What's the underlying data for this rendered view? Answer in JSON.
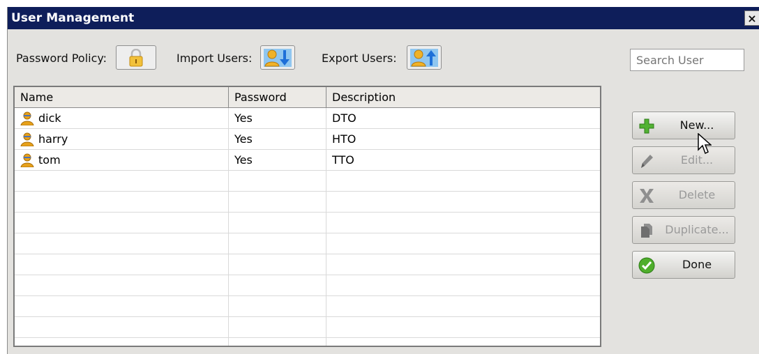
{
  "window": {
    "title": "User Management",
    "close_glyph": "×"
  },
  "toolbar": {
    "password_policy_label": "Password Policy:",
    "import_users_label": "Import Users:",
    "export_users_label": "Export Users:",
    "search_placeholder": "Search User",
    "icons": {
      "password_policy": "lock-icon",
      "import_users": "user-import-icon",
      "export_users": "user-export-icon"
    }
  },
  "table": {
    "columns": [
      "Name",
      "Password",
      "Description"
    ],
    "rows": [
      {
        "name": "dick",
        "password": "Yes",
        "description": "DTO"
      },
      {
        "name": "harry",
        "password": "Yes",
        "description": "HTO"
      },
      {
        "name": "tom",
        "password": "Yes",
        "description": "TTO"
      }
    ]
  },
  "actions": {
    "new": {
      "label": "New...",
      "icon": "plus-icon",
      "enabled": true
    },
    "edit": {
      "label": "Edit...",
      "icon": "pencil-icon",
      "enabled": false
    },
    "delete": {
      "label": "Delete",
      "icon": "x-icon",
      "enabled": false
    },
    "duplicate": {
      "label": "Duplicate...",
      "icon": "duplicate-icon",
      "enabled": false
    },
    "done": {
      "label": "Done",
      "icon": "check-icon",
      "enabled": true
    }
  },
  "colors": {
    "titlebar": "#0e1e5a",
    "panel": "#e3e2df",
    "accent_green": "#4caf2e",
    "user_icon": "#e7a11a",
    "arrow_blue": "#1e6fd8"
  }
}
